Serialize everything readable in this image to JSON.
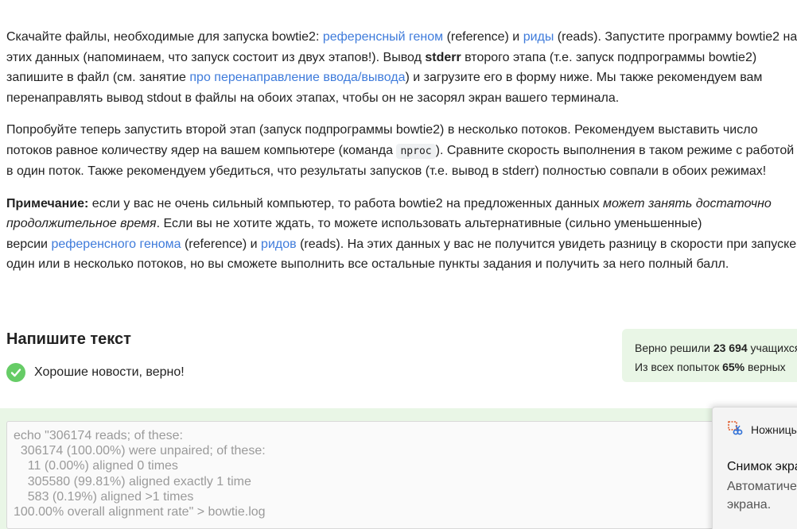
{
  "step": {
    "p1": {
      "t1": "Скачайте файлы, необходимые для запуска bowtie2: ",
      "link_genome": "референсный геном",
      "t2": " (reference) и ",
      "link_reads": "риды",
      "t3": " (reads). Запустите программу bowtie2 на",
      "t4": "этих данных (напоминаем, что запуск состоит из двух этапов!). Вывод ",
      "stderr": "stderr",
      "t5": " второго этапа (т.е. запуск подпрограммы bowtie2)",
      "t6": "запишите в файл (см. занятие ",
      "link_redirect": "про перенаправление ввода/вывода",
      "t7": ") и загрузите его в форму ниже. Мы также рекомендуем вам",
      "t8": "перенаправлять вывод stdout в файлы на обоих этапах, чтобы он не засорял экран вашего терминала."
    },
    "p2": {
      "t1": "Попробуйте теперь запустить второй этап (запуск подпрограммы bowtie2) в несколько потоков. Рекомендуем выставить число",
      "t2": "потоков равное количеству ядер на вашем компьютере (команда ",
      "code": "nproc",
      "t3": "). Сравните скорость выполнения в таком режиме с работой",
      "t4": "в один поток. Также рекомендуем убедиться, что результаты запусков (т.е. вывод в stderr) полностью совпали в обоих режимах!"
    },
    "p3": {
      "note": "Примечание:",
      "t1": " если у вас не очень сильный компьютер, то работа bowtie2 на предложенных данных ",
      "em1": "может занять достаточно",
      "em2": "продолжительное время",
      "t2": ". Если вы не хотите ждать, то можете использовать альтернативные (сильно уменьшенные)",
      "t3": "версии ",
      "link_genome": "референсного генома",
      "t4": " (reference) и ",
      "link_reads": "ридов",
      "t5": " (reads). На этих данных у вас не получится увидеть разницу в скорости при запуске в",
      "t6": "один или в несколько потоков, но вы сможете выполнить все остальные пункты задания и получить за него полный балл."
    }
  },
  "quiz": {
    "title": "Напишите текст",
    "feedback": "Хорошие новости, верно!",
    "stats": {
      "line1_prefix": "Верно решили ",
      "solved_count": "23 694",
      "line1_suffix": " учащихся",
      "line2_prefix": "Из всех попыток ",
      "percent": "65%",
      "line2_suffix": " верных"
    },
    "answer": "echo \"306174 reads; of these:\n  306174 (100.00%) were unpaired; of these:\n    11 (0.00%) aligned 0 times\n    305580 (99.81%) aligned exactly 1 time\n    583 (0.19%) aligned >1 times\n100.00% overall alignment rate\" > bowtie.log"
  },
  "notification": {
    "app_name": "Ножницы",
    "title": "Снимок экрана",
    "body": "Автоматически\nэкрана."
  },
  "colors": {
    "link": "#3e7bdb",
    "success": "#66cc66",
    "success_bg": "#e9f6e6"
  }
}
